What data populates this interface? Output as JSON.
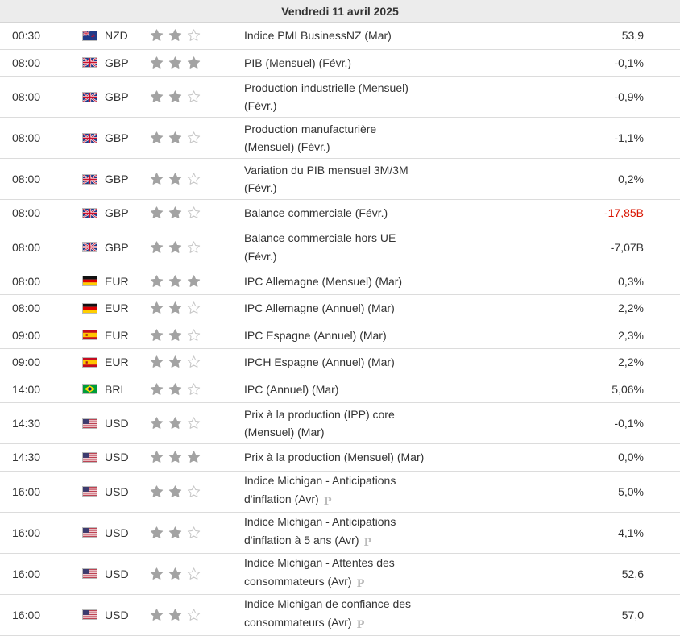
{
  "header": {
    "date": "Vendredi 11 avril 2025"
  },
  "rows": [
    {
      "time": "00:30",
      "flag": "nz",
      "currency": "NZD",
      "stars": 2,
      "event_lines": [
        "Indice PMI BusinessNZ (Mar)"
      ],
      "prelim": false,
      "actual": "53,9",
      "actual_color": "#333333"
    },
    {
      "time": "08:00",
      "flag": "gb",
      "currency": "GBP",
      "stars": 3,
      "event_lines": [
        "PIB (Mensuel) (Févr.)"
      ],
      "prelim": false,
      "actual": "-0,1%",
      "actual_color": "#333333"
    },
    {
      "time": "08:00",
      "flag": "gb",
      "currency": "GBP",
      "stars": 2,
      "event_lines": [
        "Production industrielle (Mensuel)",
        "(Févr.)"
      ],
      "prelim": false,
      "actual": "-0,9%",
      "actual_color": "#333333"
    },
    {
      "time": "08:00",
      "flag": "gb",
      "currency": "GBP",
      "stars": 2,
      "event_lines": [
        "Production manufacturière",
        "(Mensuel) (Févr.)"
      ],
      "prelim": false,
      "actual": "-1,1%",
      "actual_color": "#333333"
    },
    {
      "time": "08:00",
      "flag": "gb",
      "currency": "GBP",
      "stars": 2,
      "event_lines": [
        "Variation du PIB mensuel 3M/3M",
        "(Févr.)"
      ],
      "prelim": false,
      "actual": "0,2%",
      "actual_color": "#333333"
    },
    {
      "time": "08:00",
      "flag": "gb",
      "currency": "GBP",
      "stars": 2,
      "event_lines": [
        "Balance commerciale (Févr.)"
      ],
      "prelim": false,
      "actual": "-17,85B",
      "actual_color": "#d91400"
    },
    {
      "time": "08:00",
      "flag": "gb",
      "currency": "GBP",
      "stars": 2,
      "event_lines": [
        "Balance commerciale hors UE",
        "(Févr.)"
      ],
      "prelim": false,
      "actual": "-7,07B",
      "actual_color": "#333333"
    },
    {
      "time": "08:00",
      "flag": "de",
      "currency": "EUR",
      "stars": 3,
      "event_lines": [
        "IPC Allemagne (Mensuel) (Mar)"
      ],
      "prelim": false,
      "actual": "0,3%",
      "actual_color": "#333333"
    },
    {
      "time": "08:00",
      "flag": "de",
      "currency": "EUR",
      "stars": 2,
      "event_lines": [
        "IPC Allemagne (Annuel) (Mar)"
      ],
      "prelim": false,
      "actual": "2,2%",
      "actual_color": "#333333"
    },
    {
      "time": "09:00",
      "flag": "es",
      "currency": "EUR",
      "stars": 2,
      "event_lines": [
        "IPC Espagne (Annuel) (Mar)"
      ],
      "prelim": false,
      "actual": "2,3%",
      "actual_color": "#333333"
    },
    {
      "time": "09:00",
      "flag": "es",
      "currency": "EUR",
      "stars": 2,
      "event_lines": [
        "IPCH Espagne (Annuel) (Mar)"
      ],
      "prelim": false,
      "actual": "2,2%",
      "actual_color": "#333333"
    },
    {
      "time": "14:00",
      "flag": "br",
      "currency": "BRL",
      "stars": 2,
      "event_lines": [
        "IPC (Annuel) (Mar)"
      ],
      "prelim": false,
      "actual": "5,06%",
      "actual_color": "#333333"
    },
    {
      "time": "14:30",
      "flag": "us",
      "currency": "USD",
      "stars": 2,
      "event_lines": [
        "Prix à la production (IPP) core",
        "(Mensuel) (Mar)"
      ],
      "prelim": false,
      "actual": "-0,1%",
      "actual_color": "#333333"
    },
    {
      "time": "14:30",
      "flag": "us",
      "currency": "USD",
      "stars": 3,
      "event_lines": [
        "Prix à la production (Mensuel) (Mar)"
      ],
      "prelim": false,
      "actual": "0,0%",
      "actual_color": "#333333"
    },
    {
      "time": "16:00",
      "flag": "us",
      "currency": "USD",
      "stars": 2,
      "event_lines": [
        "Indice Michigan - Anticipations",
        "d'inflation (Avr)"
      ],
      "prelim": true,
      "actual": "5,0%",
      "actual_color": "#333333"
    },
    {
      "time": "16:00",
      "flag": "us",
      "currency": "USD",
      "stars": 2,
      "event_lines": [
        "Indice Michigan - Anticipations",
        "d'inflation à 5 ans (Avr)"
      ],
      "prelim": true,
      "actual": "4,1%",
      "actual_color": "#333333"
    },
    {
      "time": "16:00",
      "flag": "us",
      "currency": "USD",
      "stars": 2,
      "event_lines": [
        "Indice Michigan - Attentes des",
        "consommateurs (Avr)"
      ],
      "prelim": true,
      "actual": "52,6",
      "actual_color": "#333333"
    },
    {
      "time": "16:00",
      "flag": "us",
      "currency": "USD",
      "stars": 2,
      "event_lines": [
        "Indice Michigan de confiance des",
        "consommateurs (Avr)"
      ],
      "prelim": true,
      "actual": "57,0",
      "actual_color": "#333333"
    }
  ],
  "prelim_mark": "P",
  "colors": {
    "star_filled": "#a3a3a3",
    "star_empty": "#c8c8c8",
    "negative": "#d91400"
  }
}
